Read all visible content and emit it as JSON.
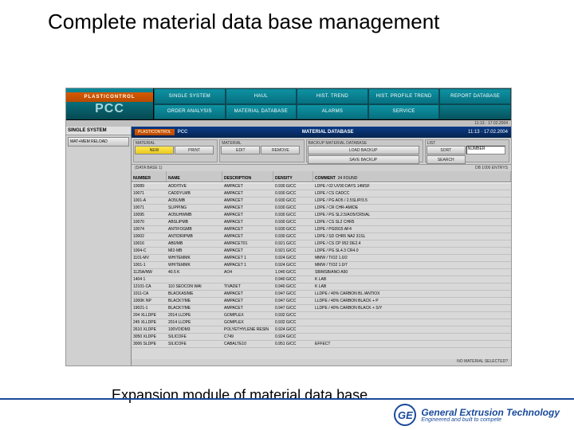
{
  "page": {
    "title": "Complete material data base management",
    "caption": "Expansion module of material data base"
  },
  "brand": {
    "bar": "PLASTICONTROL",
    "name": "PCC"
  },
  "nav": {
    "row1": [
      "SINGLE SYSTEM",
      "HAUL",
      "HIST. TREND",
      "HIST. PROFILE TREND",
      "REPORT DATABASE"
    ],
    "row2": [
      "ORDER ANALYSIS",
      "MATERIAL DATABASE",
      "ALARMS",
      "SERVICE",
      ""
    ]
  },
  "statusline": "11:13 · 17.02.2004",
  "sidebar": {
    "header": "SINGLE SYSTEM",
    "btn1": "MAT+MEM RELOAD"
  },
  "titlebar": {
    "brand": "PLASTICONTROL",
    "pcc": "PCC",
    "center": "MATERIAL DATABASE",
    "right": "11:13 · 17.02.2004"
  },
  "toolbar": {
    "g1": {
      "lbl": "MATERIAL",
      "btn1": "NEW",
      "btn2": "PRINT"
    },
    "g2": {
      "lbl": "MATERIAL",
      "btn1": "EDIT",
      "btn2": "REMOVE"
    },
    "g3": {
      "lbl": "BACKUP MATERIAL DATABASE",
      "btn1": "LOAD BACKUP",
      "btn2": "SAVE BACKUP"
    },
    "g4": {
      "lbl": "LIST",
      "btn1": "SORT",
      "btn2": "SEARCH",
      "field": "NUMBER"
    }
  },
  "datahdr_top": {
    "left": "(DATA BASE 1)",
    "right": "DB 1000 ENTRYS"
  },
  "columns": {
    "num": "NUMBER",
    "name": "NAME",
    "desc": "DESCRIPTION",
    "den": "DENSITY",
    "com": "COMMENT"
  },
  "count_label": "24 FOUND",
  "rows": [
    {
      "num": "10089",
      "name": "ADDITIVE",
      "desc": "AMPACET",
      "den": "0.930 G/CC",
      "com": "LDPE / 02 UV90 DAYS 14MSF"
    },
    {
      "num": "10071",
      "name": "CADDYLMB",
      "desc": "AMPACET",
      "den": "0.930 G/CC",
      "com": "LDPE / CS CADCC"
    },
    {
      "num": "1001-A",
      "name": "AO5UMB",
      "desc": "AMPACET",
      "den": "0.930 G/CC",
      "com": "LDPE / PG AO5 / 2.5SLIP/3.5"
    },
    {
      "num": "10071",
      "name": "SLIPPING",
      "desc": "AMPACET",
      "den": "0.930 G/CC",
      "com": "LDPE / CR CHR-AMIDE"
    },
    {
      "num": "10095",
      "name": "AO5UHWMB",
      "desc": "AMPACET",
      "den": "0.930 G/CC",
      "com": "LDPE / PG SL2.5/AO5/CR5/AL"
    },
    {
      "num": "10070",
      "name": "ABSLIPMB",
      "desc": "AMPACET",
      "den": "0.930 G/CC",
      "com": "LDPE / CS SL2 CHR5"
    },
    {
      "num": "10074",
      "name": "ANTIFOGMB",
      "desc": "AMPACET",
      "den": "0.930 G/CC",
      "com": "LDPE / PG0915 AF4"
    },
    {
      "num": "10002",
      "name": "ANTIDRIPMB",
      "desc": "AMPACET",
      "den": "0.930 G/CC",
      "com": "LDPE / SD CHR5 NA2 31SL"
    },
    {
      "num": "10016",
      "name": "AB0/MB",
      "desc": "AMPACET01",
      "den": "0.921 G/CC",
      "com": "LDPE / CS CP 952 DE2.4"
    },
    {
      "num": "1004-C",
      "name": "MI2-MB",
      "desc": "AMPACET",
      "den": "0.921 G/CC",
      "com": "LDPE / PG SL4.3 CR4.0"
    },
    {
      "num": "1101-MV",
      "name": "WHITEMMK",
      "desc": "AMPACET 1",
      "den": "0.924 G/CC",
      "com": "MMW / TIO2 1.0/2"
    },
    {
      "num": "1001-1",
      "name": "WHITEMMK",
      "desc": "AMPACET 1",
      "den": "0.924 G/CC",
      "com": "MMW / TIO2 1.0/7"
    },
    {
      "num": "1125A/NW",
      "name": "40.5 K",
      "desc": "AO4",
      "den": "1.040 G/CC",
      "com": "SB/MSB/ANO A50"
    },
    {
      "num": "1404 1",
      "name": "",
      "desc": "",
      "den": "0.940 G/CC",
      "com": "K LAB"
    },
    {
      "num": "12101-CA",
      "name": "110 SEOCON WAI",
      "desc": "TIVADET",
      "den": "0.940 G/CC",
      "com": "K LAB"
    },
    {
      "num": "1011-CA",
      "name": "BLACKA5/ME",
      "desc": "AMPACET",
      "den": "0.947 G/CC",
      "com": "LLDPE / 40% CARBON BL /ANTIOX"
    },
    {
      "num": "1000K NP",
      "name": "BLACK7/ME",
      "desc": "AMPACET",
      "den": "0.947 G/CC",
      "com": "LLDPE / 40% CARBON BLACK + P"
    },
    {
      "num": "19021-1",
      "name": "BLACK7/ME",
      "desc": "AMPACET",
      "den": "0.947 G/CC",
      "com": "LLDPE / 40% CARBON BLACK + S/Y"
    },
    {
      "num": "204 XLLDPE",
      "name": "2014 LLDPE",
      "desc": "GOMPLEX",
      "den": "0.932 G/CC",
      "com": ""
    },
    {
      "num": "245 XLLDPE",
      "name": "2014 LLDPE",
      "desc": "GOMPLEX",
      "den": "0.932 G/CC",
      "com": ""
    },
    {
      "num": "2610 XLDPE",
      "name": "100VOIDM3",
      "desc": "POLYETHYLENE RESIN",
      "den": "0.924 G/CC",
      "com": ""
    },
    {
      "num": "3050 XLDPE",
      "name": "SILICOFE",
      "desc": "C749",
      "den": "0.924 G/CC",
      "com": ""
    },
    {
      "num": "3006 SLDPE",
      "name": "SILICOFE",
      "desc": "CABALTE10",
      "den": "0.951 G/CC",
      "com": "EFFECT"
    }
  ],
  "footer_status": "NO MATERIAL SELECTED?",
  "company": {
    "name": "General Extrusion Technology",
    "tag": "Engineered and built to compete",
    "logo": "GE"
  }
}
